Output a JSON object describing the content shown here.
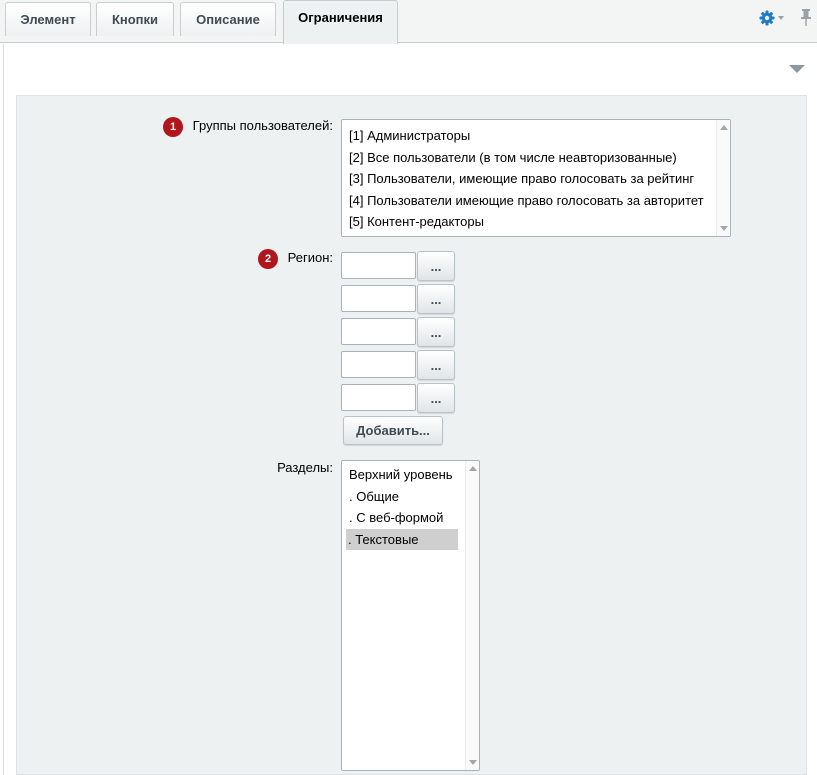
{
  "tabs": [
    {
      "label": "Элемент",
      "active": false
    },
    {
      "label": "Кнопки",
      "active": false
    },
    {
      "label": "Описание",
      "active": false
    },
    {
      "label": "Ограничения",
      "active": true
    }
  ],
  "toolbar": {
    "settings_icon": "gear-icon",
    "pin_icon": "pin-icon",
    "accent_color": "#1e7bc7"
  },
  "form": {
    "user_groups": {
      "badge": "1",
      "label": "Группы пользователей:",
      "options": [
        "[1] Администраторы",
        "[2] Все пользователи (в том числе неавторизованные)",
        "[3] Пользователи, имеющие право голосовать за рейтинг",
        "[4] Пользователи имеющие право голосовать за авторитет",
        "[5] Контент-редакторы"
      ]
    },
    "region": {
      "badge": "2",
      "label": "Регион:",
      "inputs": [
        "",
        "",
        "",
        "",
        ""
      ],
      "browse_label": "...",
      "add_label": "Добавить..."
    },
    "sections": {
      "label": "Разделы:",
      "options": [
        {
          "text": "Верхний уровень",
          "selected": false
        },
        {
          "text": ". Общие",
          "selected": false
        },
        {
          "text": ". С веб-формой",
          "selected": false
        },
        {
          "text": ". Текстовые",
          "selected": true
        }
      ]
    }
  },
  "colors": {
    "badge": "#b0161c",
    "panel": "#eef1f2",
    "selected_row": "#cfcfcf"
  }
}
